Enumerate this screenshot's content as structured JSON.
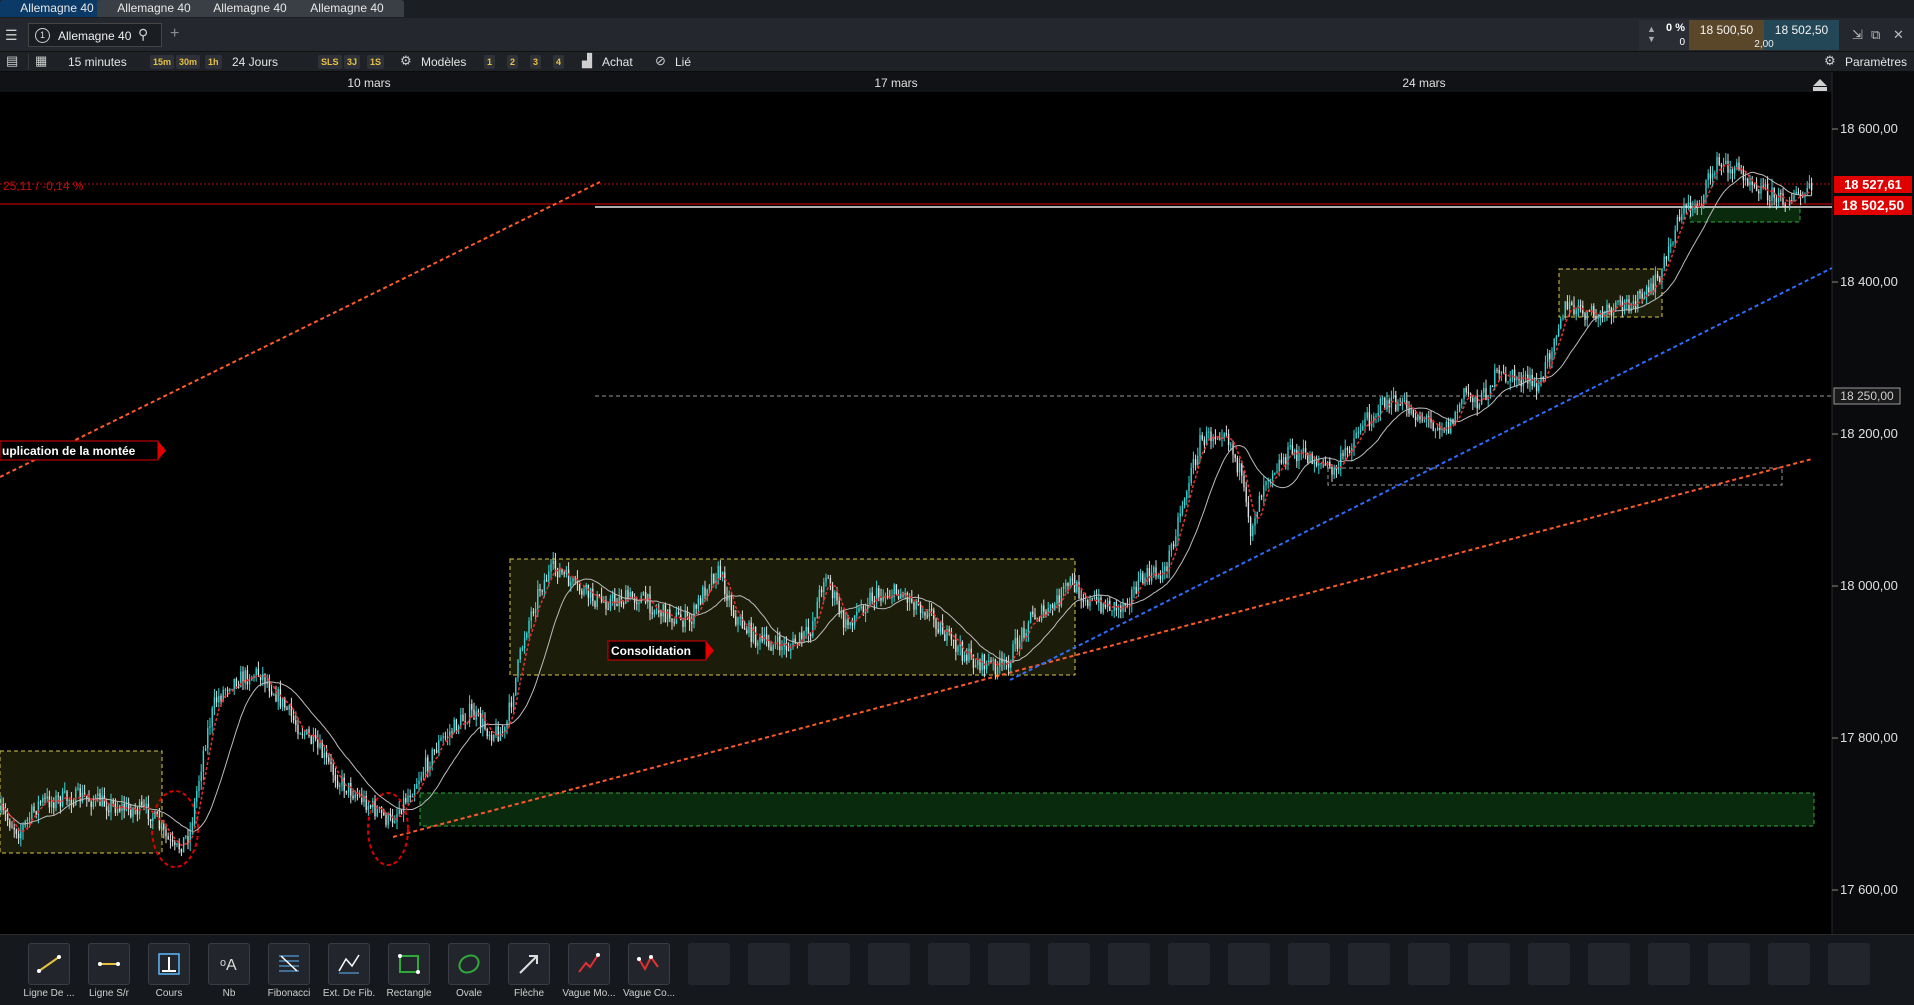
{
  "tabs": [
    "Allemagne 40",
    "Allemagne 40",
    "Allemagne 40",
    "Allemagne 40"
  ],
  "window": {
    "instrument_number": "1",
    "instrument": "Allemagne 40",
    "change_pct": "0 %",
    "change_abs": "0",
    "sell": "18 500,50",
    "buy": "18 502,50",
    "spread": "2,00"
  },
  "toolbar": {
    "interval": "15 minutes",
    "quick_intervals": [
      "15m",
      "30m",
      "1h"
    ],
    "range": "24 Jours",
    "quick_ranges": [
      "SLS",
      "3J",
      "1S"
    ],
    "templates_label": "Modèles",
    "template_slots": [
      "1",
      "2",
      "3",
      "4"
    ],
    "buy_label": "Achat",
    "link_label": "Lié",
    "settings_label": "Paramètres"
  },
  "chart": {
    "date_labels": [
      "10 mars",
      "17 mars",
      "24 mars"
    ],
    "price_labels": [
      "18 600,00",
      "18 400,00",
      "18 250,00",
      "18 200,00",
      "18 000,00",
      "17 800,00",
      "17 600,00"
    ],
    "last_ask": "18 527,61",
    "last_price": "18 502,50",
    "change_text": "25,11 / -0,14 %",
    "annotation_projection": "uplication de la montée",
    "annotation_consolidation": "Consolidation",
    "colors": {
      "candle_up": "#3bd6d6",
      "candle_down": "#e0e0e0",
      "ma_fast": "#e03030",
      "ma_slow": "#bcbcbc",
      "trend_red": "#ff5a2a",
      "trend_blue": "#2f6bff",
      "zone_yellow": "#d8c84a",
      "zone_green": "#2faa3a",
      "price_red": "#e00000"
    }
  },
  "tools": [
    {
      "label": "Ligne De ...",
      "icon": "trend-line-icon"
    },
    {
      "label": "Ligne S/r",
      "icon": "support-line-icon"
    },
    {
      "label": "Cours",
      "icon": "price-level-icon"
    },
    {
      "label": "Nb",
      "icon": "text-note-icon"
    },
    {
      "label": "Fibonacci",
      "icon": "fibonacci-icon"
    },
    {
      "label": "Ext. De Fib.",
      "icon": "fib-extension-icon"
    },
    {
      "label": "Rectangle",
      "icon": "rectangle-icon"
    },
    {
      "label": "Ovale",
      "icon": "oval-icon"
    },
    {
      "label": "Flèche",
      "icon": "arrow-icon"
    },
    {
      "label": "Vague Mo...",
      "icon": "wave-icon"
    },
    {
      "label": "Vague Co...",
      "icon": "wave-correction-icon"
    }
  ]
}
